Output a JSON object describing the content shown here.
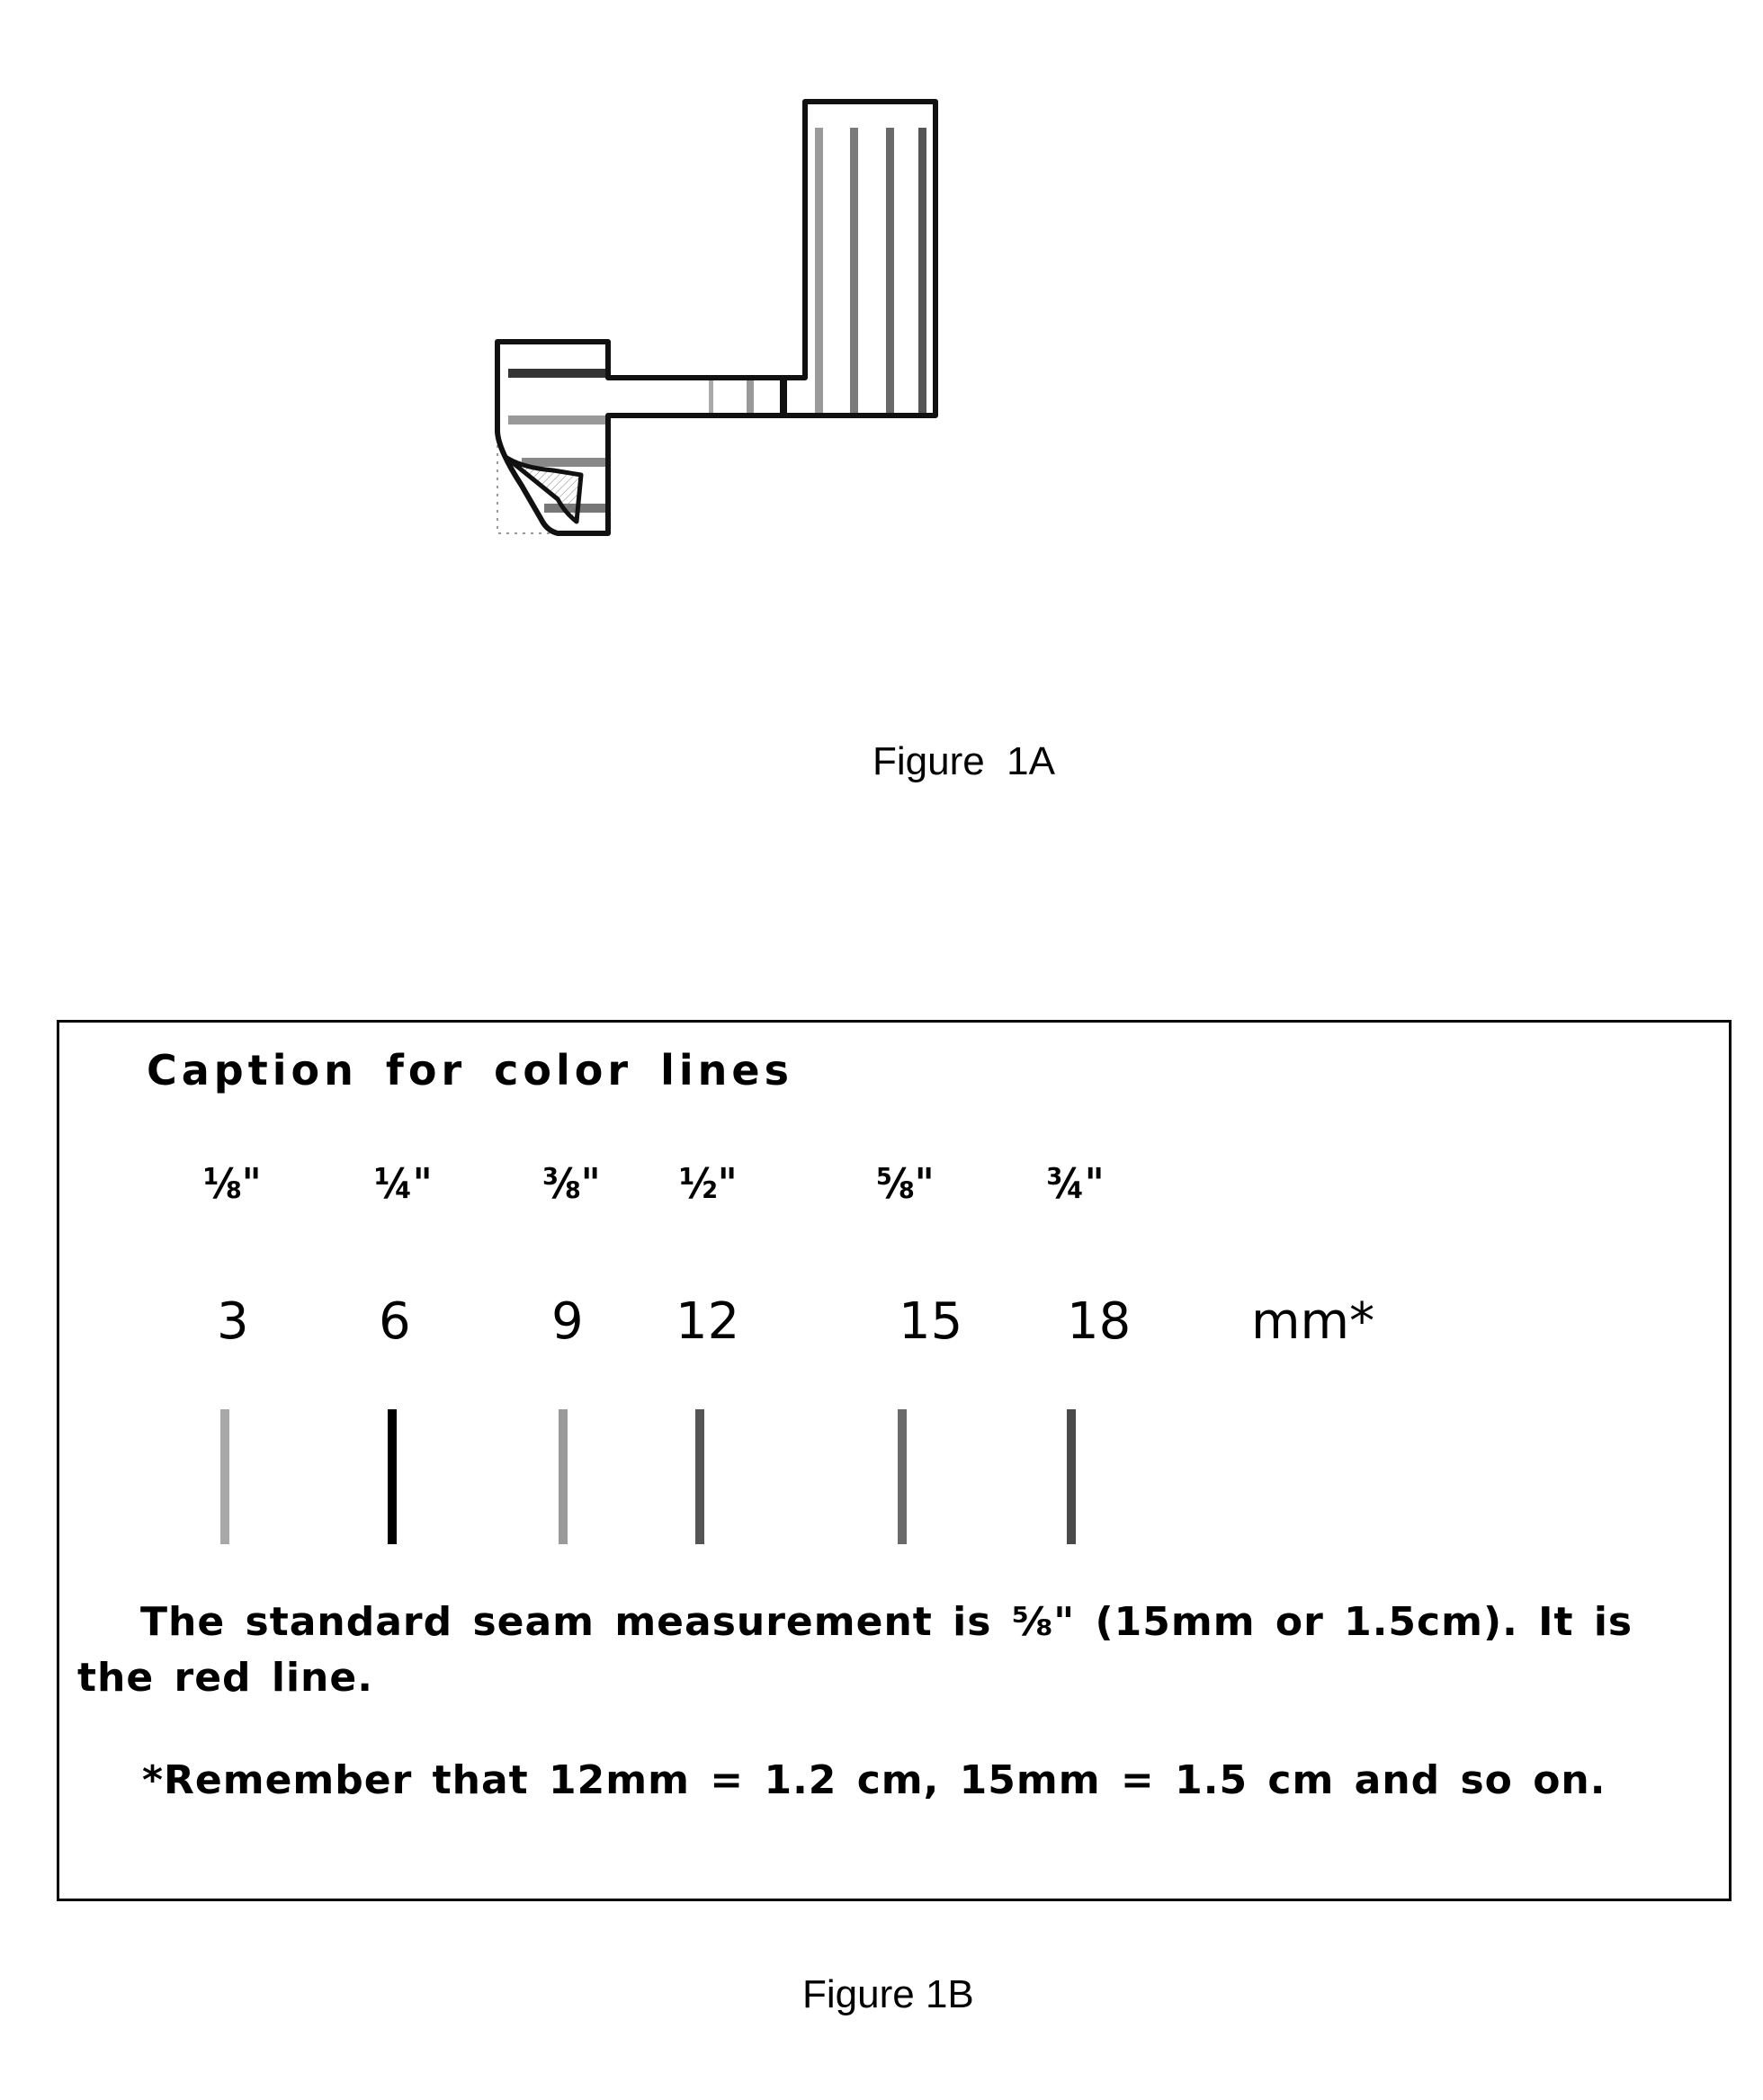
{
  "figure_1a": {
    "label": "Figure  1A",
    "description": "Garment pattern piece with colored seam allowance lines",
    "line_shades": {
      "light": "#9a9a9a",
      "black": "#111111",
      "medium": "#7a7a7a",
      "dark": "#555555",
      "red": "#666666",
      "darkest": "#444444"
    }
  },
  "figure_1b": {
    "label": "Figure 1B",
    "caption_title": "Caption for color lines",
    "fractions": [
      "⅛\"",
      "¼\"",
      "⅜\"",
      "½\"",
      "⅝\"",
      "¾\""
    ],
    "millimeters": [
      "3",
      "6",
      "9",
      "12",
      "15",
      "18"
    ],
    "unit_label": "mm*",
    "swatches": [
      {
        "inch": "1/8",
        "mm": 3,
        "shade": "#a8a8a8"
      },
      {
        "inch": "1/4",
        "mm": 6,
        "shade": "#000000"
      },
      {
        "inch": "3/8",
        "mm": 9,
        "shade": "#9a9a9a"
      },
      {
        "inch": "1/2",
        "mm": 12,
        "shade": "#555555"
      },
      {
        "inch": "5/8",
        "mm": 15,
        "shade": "#6a6a6a"
      },
      {
        "inch": "3/4",
        "mm": 18,
        "shade": "#4a4a4a"
      }
    ],
    "seam_text": "The standard seam measurement is ⅝\" (15mm or 1.5cm).  It is the red line.",
    "remember_text": "*Remember that 12mm = 1.2 cm, 15mm = 1.5 cm and so on."
  }
}
